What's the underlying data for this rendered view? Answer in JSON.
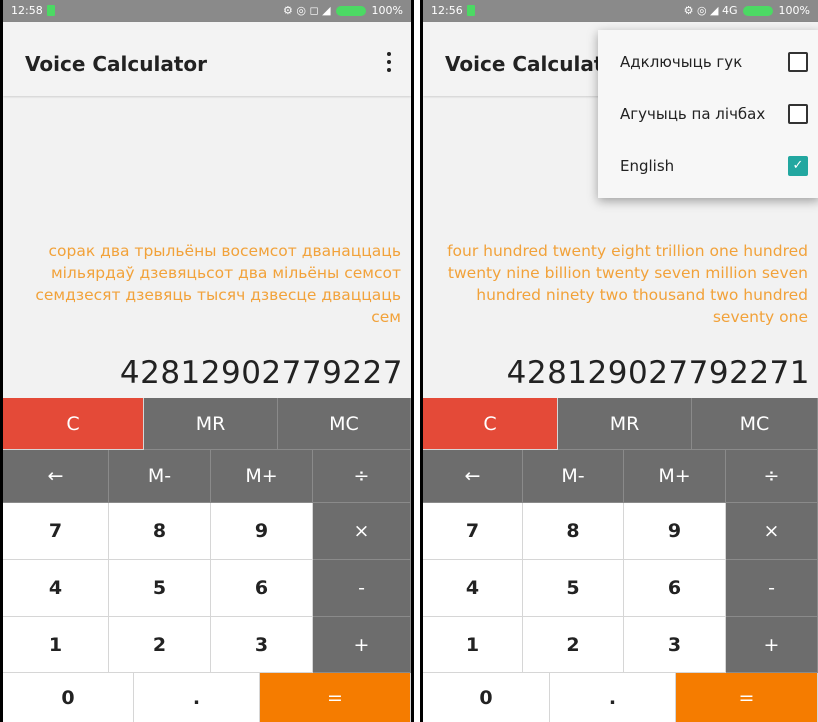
{
  "left": {
    "status": {
      "time": "12:58",
      "icons": "⚙ ◎ ◻ ◢",
      "battery": "100%"
    },
    "app_title": "Voice Calculator",
    "words": "сорак два трыльёны восемсот дванаццаць мільярдаў дзевяцьсот два мільёны семсот семдзесят дзевяць тысяч дзвесце дваццаць сем",
    "number": "42812902779227"
  },
  "right": {
    "status": {
      "time": "12:56",
      "icons": "⚙ ◎ ◢ 4G",
      "battery": "100%"
    },
    "app_title": "Voice Calculato",
    "words": "four hundred twenty eight trillion one hundred twenty nine billion twenty seven million seven hundred ninety two thousand two hundred seventy one",
    "number": "428129027792271",
    "menu": [
      {
        "label": "Адключыць гук",
        "checked": false
      },
      {
        "label": "Агучыць па лічбах",
        "checked": false
      },
      {
        "label": "English",
        "checked": true
      }
    ]
  },
  "keys": {
    "clear": "C",
    "mr": "MR",
    "mc": "MC",
    "back": "←",
    "mminus": "M-",
    "mplus": "M+",
    "div": "÷",
    "n7": "7",
    "n8": "8",
    "n9": "9",
    "mul": "×",
    "n4": "4",
    "n5": "5",
    "n6": "6",
    "minus": "-",
    "n1": "1",
    "n2": "2",
    "n3": "3",
    "plus": "+",
    "n0": "0",
    "dot": ".",
    "eq": "="
  },
  "colors": {
    "clear": "#e44a38",
    "dark_key": "#6d6d6d",
    "equals": "#f57c00",
    "result_words": "#f2a23a",
    "checkbox_on": "#22a7a0"
  }
}
